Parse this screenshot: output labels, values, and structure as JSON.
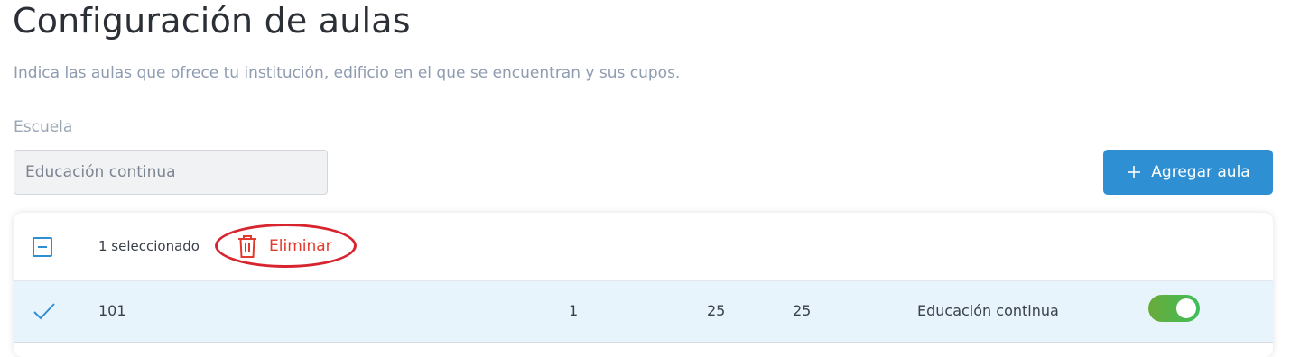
{
  "page": {
    "title": "Configuración de aulas",
    "subtitle": "Indica las aulas que ofrece tu institución, edificio en el que se encuentran y sus cupos."
  },
  "school_field": {
    "label": "Escuela",
    "value": "Educación continua"
  },
  "add_button": {
    "label": "Agregar aula",
    "icon": "plus-icon"
  },
  "table": {
    "selection": {
      "count_label": "1 seleccionado",
      "delete_label": "Eliminar",
      "delete_icon": "trash-icon",
      "delete_color": "#e23a2e"
    },
    "rows": [
      {
        "selected": true,
        "name": "101",
        "col2": "1",
        "col3": "25",
        "col4": "25",
        "school": "Educación continua",
        "active": true
      }
    ]
  },
  "colors": {
    "accent": "#2e8fd3",
    "selected_row_bg": "#e8f4fb",
    "toggle_on": "#4cb84a"
  }
}
